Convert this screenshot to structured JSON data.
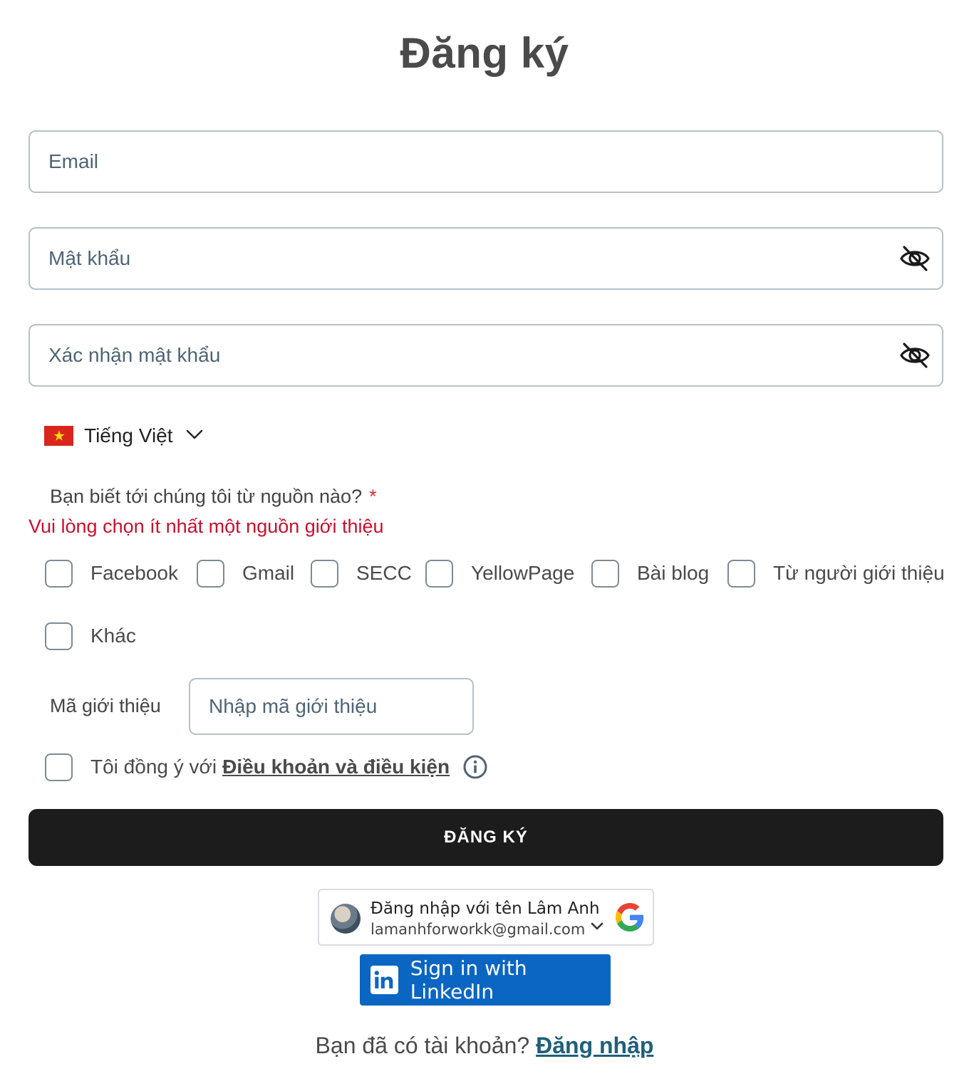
{
  "title": "Đăng ký",
  "fields": {
    "email_placeholder": "Email",
    "password_placeholder": "Mật khẩu",
    "confirm_password_placeholder": "Xác nhận mật khẩu"
  },
  "language": {
    "label": "Tiếng Việt"
  },
  "source_question": {
    "label": "Bạn biết tới chúng tôi từ nguồn nào?",
    "required_mark": "*"
  },
  "error_message": "Vui lòng chọn ít nhất một nguồn giới thiệu",
  "sources": [
    {
      "label": "Facebook",
      "checked": false
    },
    {
      "label": "Gmail",
      "checked": false
    },
    {
      "label": "SECC",
      "checked": false
    },
    {
      "label": "YellowPage",
      "checked": false
    },
    {
      "label": "Bài blog",
      "checked": false
    },
    {
      "label": "Từ người giới thiệu",
      "checked": false
    },
    {
      "label": "Khác",
      "checked": false
    }
  ],
  "referral": {
    "label": "Mã giới thiệu",
    "placeholder": "Nhập mã giới thiệu"
  },
  "terms": {
    "prefix": "Tôi đồng ý với",
    "link": "Điều khoản và điều kiện",
    "checked": false
  },
  "submit_label": "ĐĂNG KÝ",
  "google": {
    "name_line": "Đăng nhập với tên Lâm Anh",
    "email": "lamanhforworkk@gmail.com"
  },
  "linkedin": {
    "label": "Sign in with LinkedIn"
  },
  "footer": {
    "prompt": "Bạn đã có tài khoản?",
    "link": "Đăng nhập"
  },
  "colors": {
    "error": "#c8102e",
    "primary_button": "#1c1c1c",
    "linkedin": "#0a66c2",
    "link": "#1f5f7a"
  },
  "icons": [
    "eye-off-icon",
    "vietnam-flag-icon",
    "chevron-down-icon",
    "info-icon",
    "google-logo-icon",
    "linkedin-logo-icon"
  ]
}
